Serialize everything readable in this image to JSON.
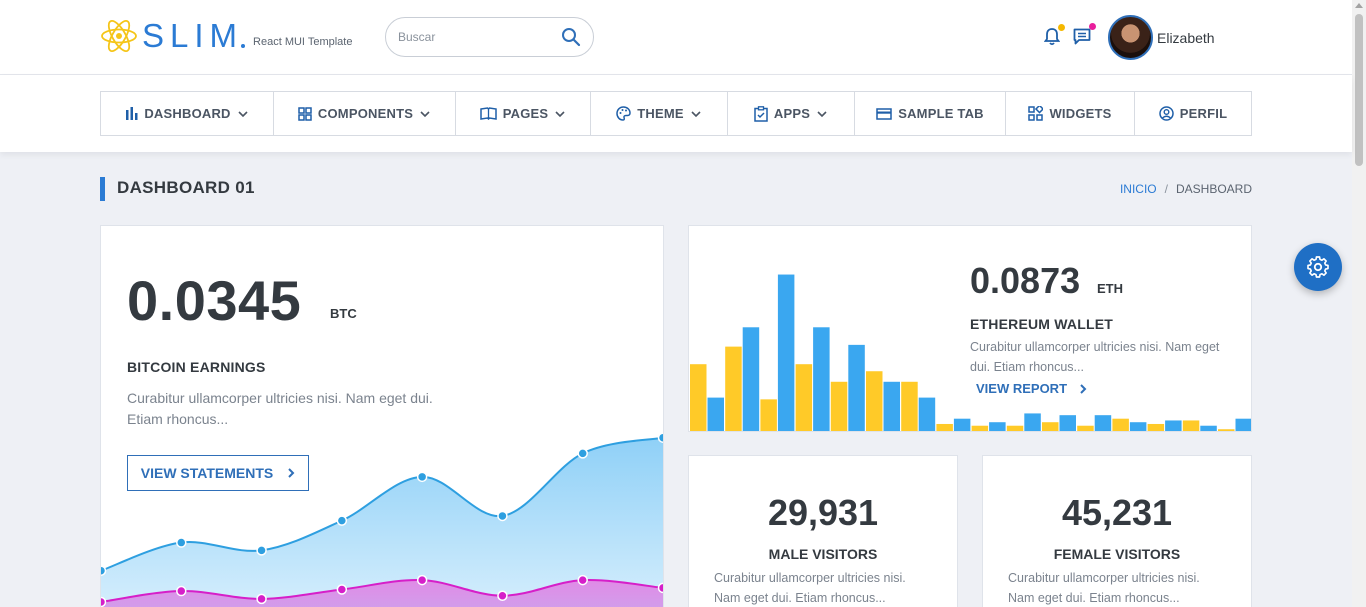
{
  "brand": {
    "name": "SLIM",
    "subtitle": "React MUI Template"
  },
  "search": {
    "placeholder": "Buscar"
  },
  "user": {
    "name": "Elizabeth"
  },
  "badges": {
    "notifications_color": "#f5b800",
    "messages_color": "#e91e9c"
  },
  "nav": {
    "items": [
      {
        "label": "DASHBOARD",
        "icon": "bar-chart-icon",
        "has_dropdown": true
      },
      {
        "label": "COMPONENTS",
        "icon": "grid-icon",
        "has_dropdown": true
      },
      {
        "label": "PAGES",
        "icon": "book-icon",
        "has_dropdown": true
      },
      {
        "label": "THEME",
        "icon": "palette-icon",
        "has_dropdown": true
      },
      {
        "label": "APPS",
        "icon": "clipboard-check-icon",
        "has_dropdown": true
      },
      {
        "label": "SAMPLE TAB",
        "icon": "card-icon",
        "has_dropdown": false
      },
      {
        "label": "WIDGETS",
        "icon": "widgets-icon",
        "has_dropdown": false
      },
      {
        "label": "PERFIL",
        "icon": "user-circle-icon",
        "has_dropdown": false
      }
    ]
  },
  "page": {
    "title": "DASHBOARD 01",
    "breadcrumb": {
      "home": "INICIO",
      "separator": "/",
      "current": "DASHBOARD"
    }
  },
  "bitcoin": {
    "value": "0.0345",
    "unit": "BTC",
    "label": "BITCOIN EARNINGS",
    "description": "Curabitur ullamcorper ultricies nisi. Nam eget dui. Etiam rhoncus...",
    "button": "VIEW STATEMENTS"
  },
  "ethereum": {
    "value": "0.0873",
    "unit": "ETH",
    "label": "ETHEREUM WALLET",
    "description": "Curabitur ullamcorper ultricies nisi. Nam eget dui. Etiam rhoncus...",
    "button": "VIEW REPORT"
  },
  "male": {
    "value": "29,931",
    "label": "MALE VISITORS",
    "description": "Curabitur ullamcorper ultricies nisi. Nam eget dui. Etiam rhoncus..."
  },
  "female": {
    "value": "45,231",
    "label": "FEMALE VISITORS",
    "description": "Curabitur ullamcorper ultricies nisi. Nam eget dui. Etiam rhoncus..."
  },
  "chart_data": [
    {
      "type": "area",
      "series": [
        {
          "values": [
            20,
            38,
            33,
            52,
            80,
            55,
            95,
            105
          ],
          "color": "#2e9fe0"
        },
        {
          "values": [
            0,
            7,
            2,
            8,
            14,
            4,
            14,
            9
          ],
          "color": "#d61fc9"
        }
      ],
      "ylim": [
        0,
        170
      ]
    },
    {
      "type": "bar",
      "series": [
        {
          "values": [
            38,
            48,
            18,
            38,
            28,
            34,
            28,
            4,
            3,
            3,
            5,
            3,
            7,
            4,
            6,
            1,
            3
          ],
          "color": "#ffca28"
        },
        {
          "values": [
            19,
            59,
            89,
            59,
            49,
            28,
            19,
            7,
            5,
            10,
            9,
            9,
            5,
            6,
            3,
            7,
            9
          ],
          "color": "#3aa7f0"
        }
      ],
      "ylim": [
        0,
        95
      ]
    }
  ],
  "colors": {
    "accent": "#2b7bd4",
    "fab": "#1f6fc5"
  }
}
